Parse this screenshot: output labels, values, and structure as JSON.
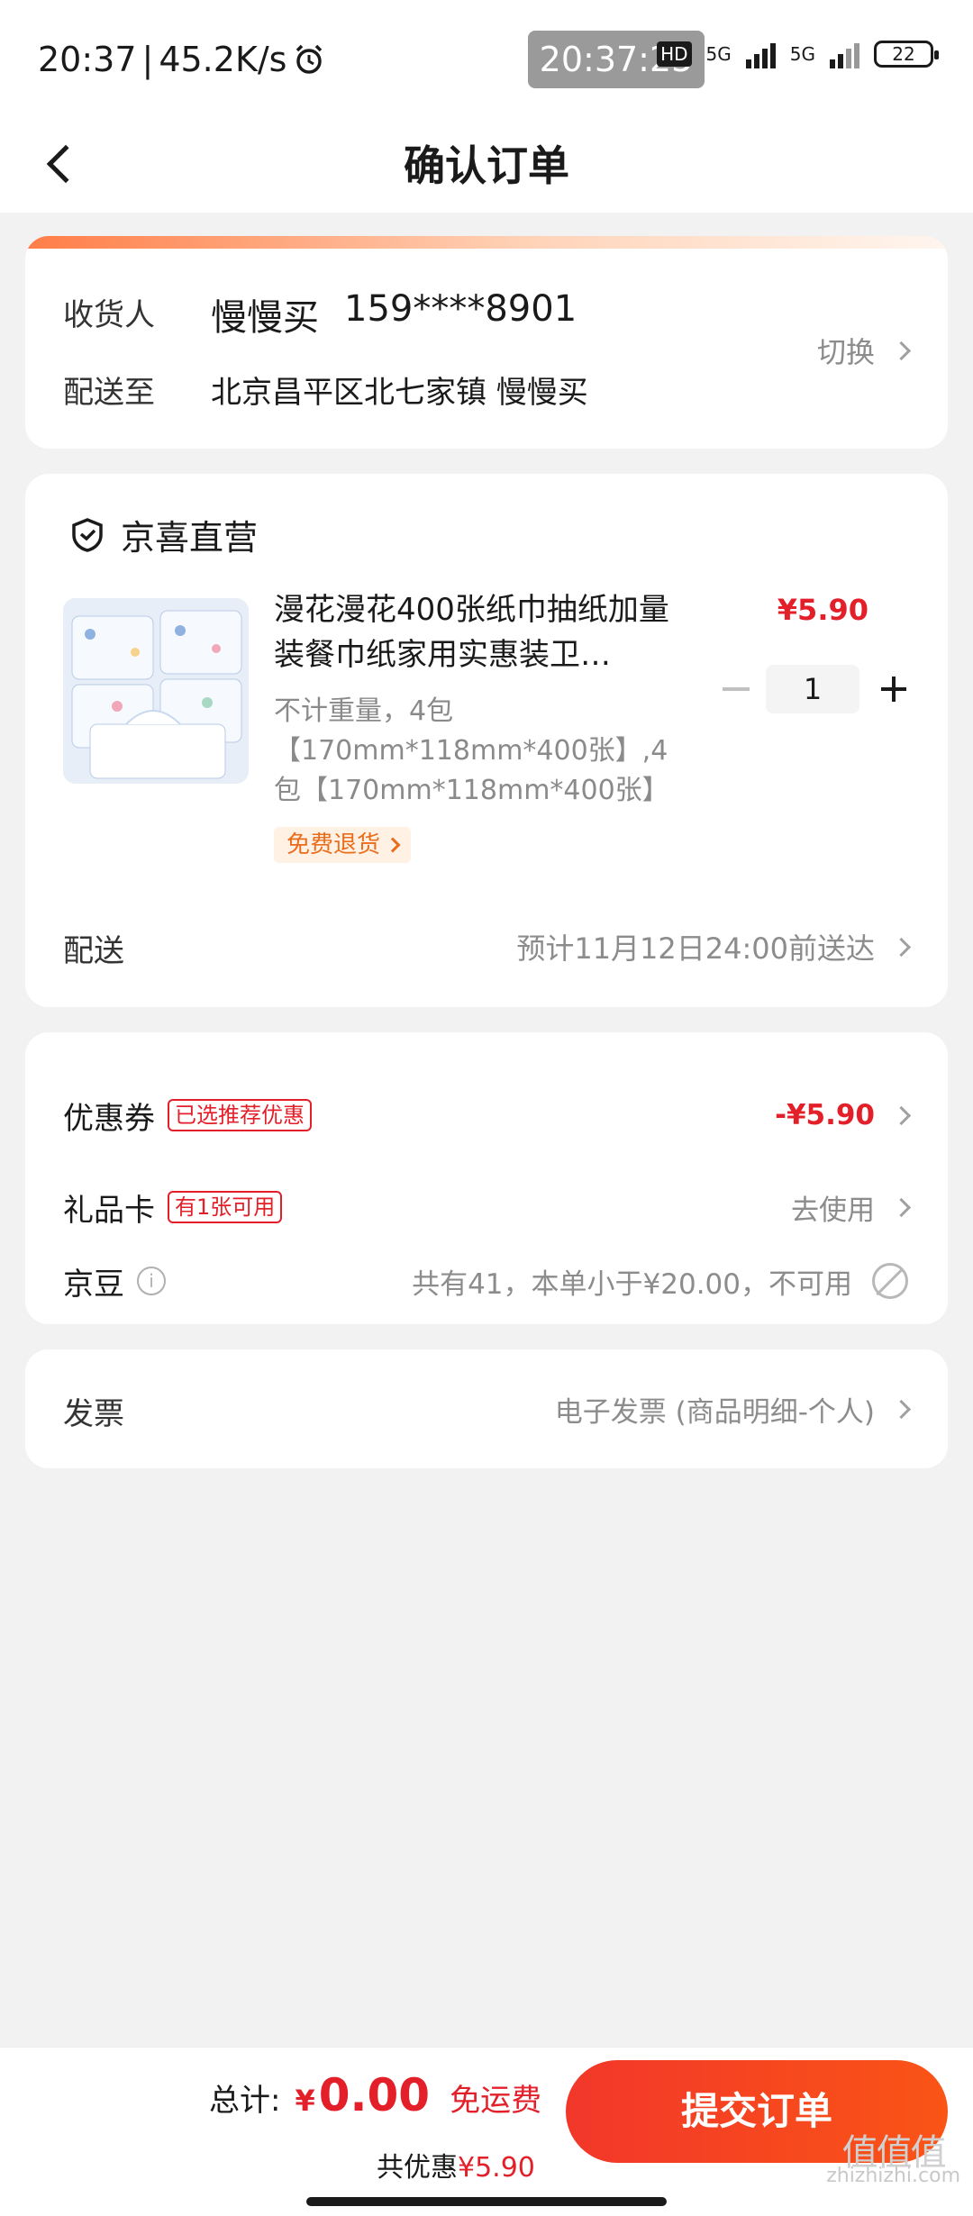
{
  "status_bar": {
    "time": "20:37",
    "net_speed": "45.2K/s",
    "overlay_time": "20:37:25",
    "network_labels": [
      "HD",
      "5G",
      "5G"
    ],
    "battery": "22"
  },
  "nav": {
    "title": "确认订单"
  },
  "address": {
    "receiver_label": "收货人",
    "receiver_name": "慢慢买",
    "phone": "159****8901",
    "deliver_label": "配送至",
    "address_text": "北京昌平区北七家镇 慢慢买",
    "switch_label": "切换"
  },
  "product": {
    "shop_name": "京喜直营",
    "title": "漫花漫花400张纸巾抽纸加量装餐巾纸家用实惠装卫…",
    "spec": "不计重量，4包【170mm*118mm*400张】,4包【170mm*118mm*400张】",
    "badge": "免费退货",
    "price": "¥5.90",
    "quantity": "1",
    "delivery_label": "配送",
    "delivery_value": "预计11月12日24:00前送达"
  },
  "discounts": {
    "coupon_label": "优惠券",
    "coupon_tag": "已选推荐优惠",
    "coupon_value": "-¥5.90",
    "giftcard_label": "礼品卡",
    "giftcard_tag": "有1张可用",
    "giftcard_value": "去使用",
    "beans_label": "京豆",
    "beans_value": "共有41，本单小于¥20.00，不可用"
  },
  "invoice": {
    "label": "发票",
    "value": "电子发票 (商品明细-个人)"
  },
  "footer": {
    "total_label": "总计:",
    "currency": "¥",
    "total_amount": "0.00",
    "shipping_note": "免运费",
    "saved_label": "共优惠",
    "saved_amount": "¥5.90",
    "submit_label": "提交订单"
  },
  "watermark": {
    "logo_text": "值值值",
    "site": "zhizhizhi.com"
  },
  "colors": {
    "accent_red": "#e3202a",
    "submit_gradient": [
      "#f2372a",
      "#fa5416"
    ],
    "page_bg": "#f2f2f2"
  }
}
